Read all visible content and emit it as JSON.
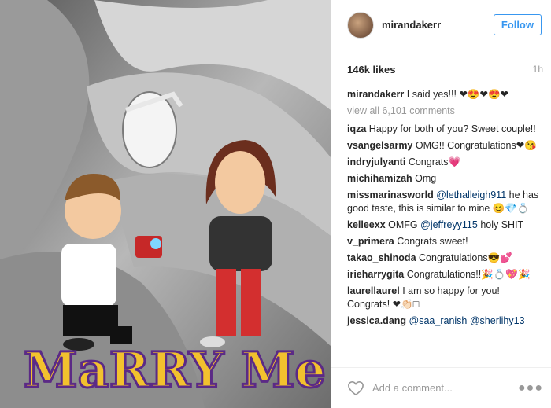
{
  "header": {
    "username": "mirandakerr",
    "follow_label": "Follow"
  },
  "meta": {
    "likes": "146k likes",
    "time": "1h"
  },
  "caption": {
    "user": "mirandakerr",
    "text": "I said yes!!! ❤😍❤😍❤"
  },
  "view_all": "view all 6,101 comments",
  "comments": [
    {
      "user": "iqza",
      "text": "Happy for both of you? Sweet couple!!"
    },
    {
      "user": "vsangelsarmy",
      "text": "OMG!! Congratulations❤😘"
    },
    {
      "user": "indryjulyanti",
      "text": "Congrats💗"
    },
    {
      "user": "michihamizah",
      "text": "Omg"
    },
    {
      "user": "missmarinasworld",
      "mention": "@lethalleigh911",
      "text": "he has good taste, this is similar to mine 😊💎💍"
    },
    {
      "user": "kelleexx",
      "pre": "OMFG",
      "mention": "@jeffreyy115",
      "text": "holy SHIT"
    },
    {
      "user": "v_primera",
      "text": "Congrats sweet!"
    },
    {
      "user": "takao_shinoda",
      "text": "Congratulations😎💕"
    },
    {
      "user": "irieharrygita",
      "text": "Congratulations!!🎉💍💖🎉"
    },
    {
      "user": "laurellaurel",
      "text": "I am so happy for you! Congrats! ❤👏🏻□"
    },
    {
      "user": "jessica.dang",
      "mention": "@saa_ranish",
      "mention2": "@sherlihy13"
    }
  ],
  "footer": {
    "add_comment_placeholder": "Add a comment...",
    "more_icon": "ellipsis-icon",
    "heart_icon": "heart-outline-icon"
  },
  "photo": {
    "banner_text": "MaRRY Me!"
  },
  "colors": {
    "accent": "#3897f0",
    "banner": "#f2c12e",
    "banner_stroke": "#5b2a86"
  }
}
